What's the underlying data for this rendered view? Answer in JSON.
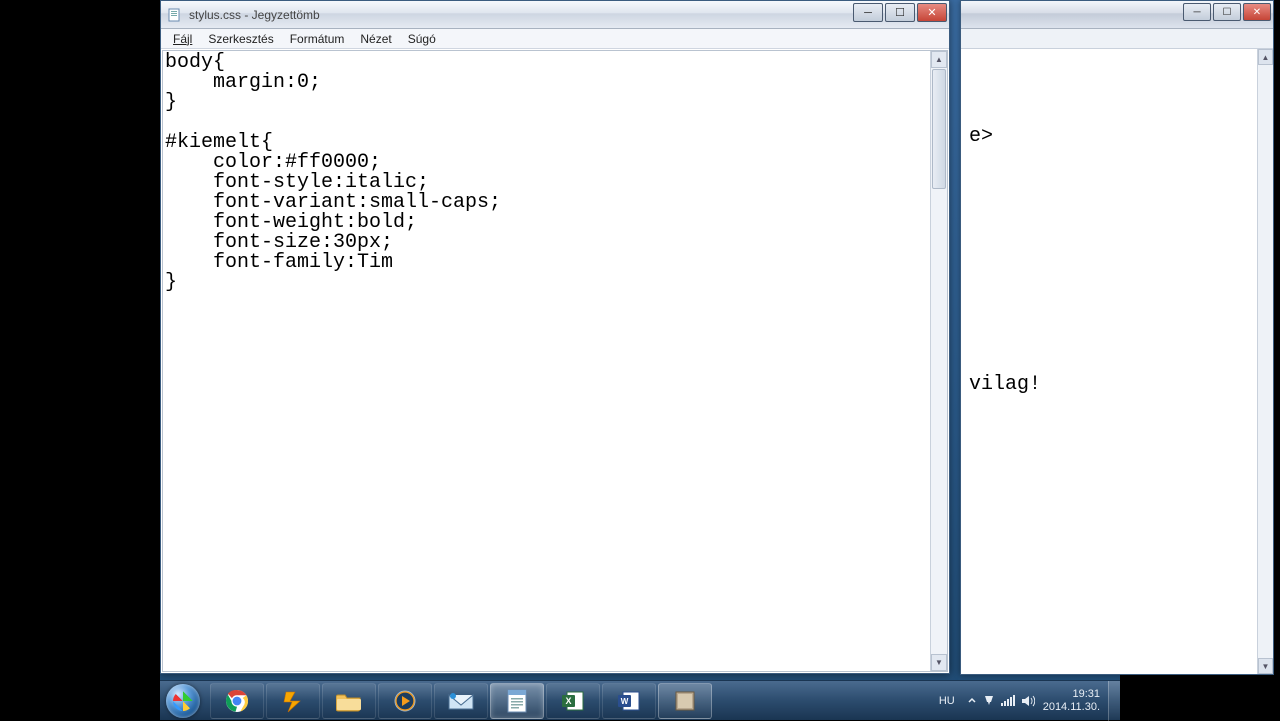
{
  "main_window": {
    "title": "stylus.css - Jegyzettömb",
    "menu": {
      "file": "Fájl",
      "edit": "Szerkesztés",
      "format": "Formátum",
      "view": "Nézet",
      "help": "Súgó"
    },
    "content": "body{\n    margin:0;\n}\n\n#kiemelt{\n    color:#ff0000;\n    font-style:italic;\n    font-variant:small-caps;\n    font-weight:bold;\n    font-size:30px;\n    font-family:Tim\n}"
  },
  "back_window": {
    "visible_line1": "e>",
    "visible_line2": "vilag!"
  },
  "taskbar": {
    "lang": "HU",
    "time": "19:31",
    "date": "2014.11.30."
  }
}
